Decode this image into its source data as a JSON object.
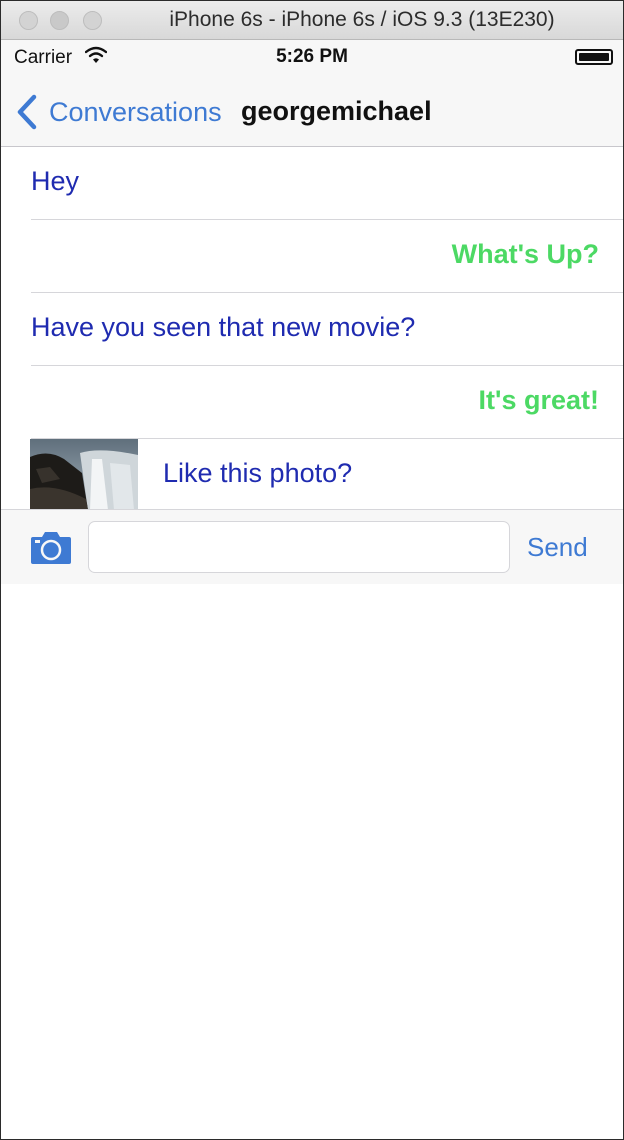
{
  "window": {
    "title": "iPhone 6s - iPhone 6s / iOS 9.3 (13E230)"
  },
  "status_bar": {
    "carrier": "Carrier",
    "time": "5:26 PM",
    "battery_level": 1.0
  },
  "nav": {
    "back_label": "Conversations",
    "title": "georgemichael"
  },
  "messages": [
    {
      "text": "Hey",
      "side": "left"
    },
    {
      "text": "What's Up?",
      "side": "right"
    },
    {
      "text": "Have you seen that new movie?",
      "side": "left"
    },
    {
      "text": "It's great!",
      "side": "right"
    },
    {
      "text": "Like this photo?",
      "side": "left",
      "has_photo": true
    }
  ],
  "input_bar": {
    "field_value": "",
    "send_label": "Send"
  },
  "colors": {
    "accent": "#3e7ad3",
    "incoming": "#1f2bb0",
    "outgoing": "#4cd964"
  }
}
